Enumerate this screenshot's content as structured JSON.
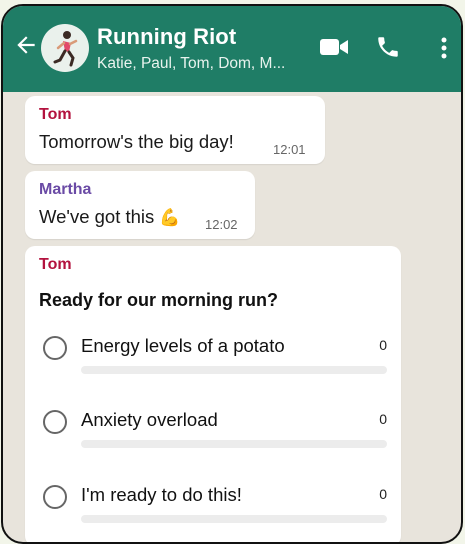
{
  "header": {
    "title": "Running Riot",
    "subtitle": "Katie, Paul, Tom, Dom, M...",
    "icons": {
      "back": "back-arrow-icon",
      "avatar": "runner-avatar",
      "video": "video-call-icon",
      "phone": "voice-call-icon",
      "more": "more-options-icon"
    }
  },
  "messages": [
    {
      "sender": "Tom",
      "sender_color": "#b3123e",
      "text": "Tomorrow's the big day!",
      "time": "12:01"
    },
    {
      "sender": "Martha",
      "sender_color": "#6a4aa5",
      "text": "We've got this",
      "emoji": "💪",
      "time": "12:02"
    }
  ],
  "poll": {
    "sender": "Tom",
    "sender_color": "#b3123e",
    "question": "Ready for our morning run?",
    "options": [
      {
        "label": "Energy levels of a potato",
        "count": "0",
        "fraction": 0
      },
      {
        "label": "Anxiety overload",
        "count": "0",
        "fraction": 0
      },
      {
        "label": "I'm ready to do this!",
        "count": "0",
        "fraction": 0
      }
    ]
  },
  "colors": {
    "header": "#1f7d66",
    "chat_background": "#e8e4dc",
    "bubble": "#ffffff"
  }
}
